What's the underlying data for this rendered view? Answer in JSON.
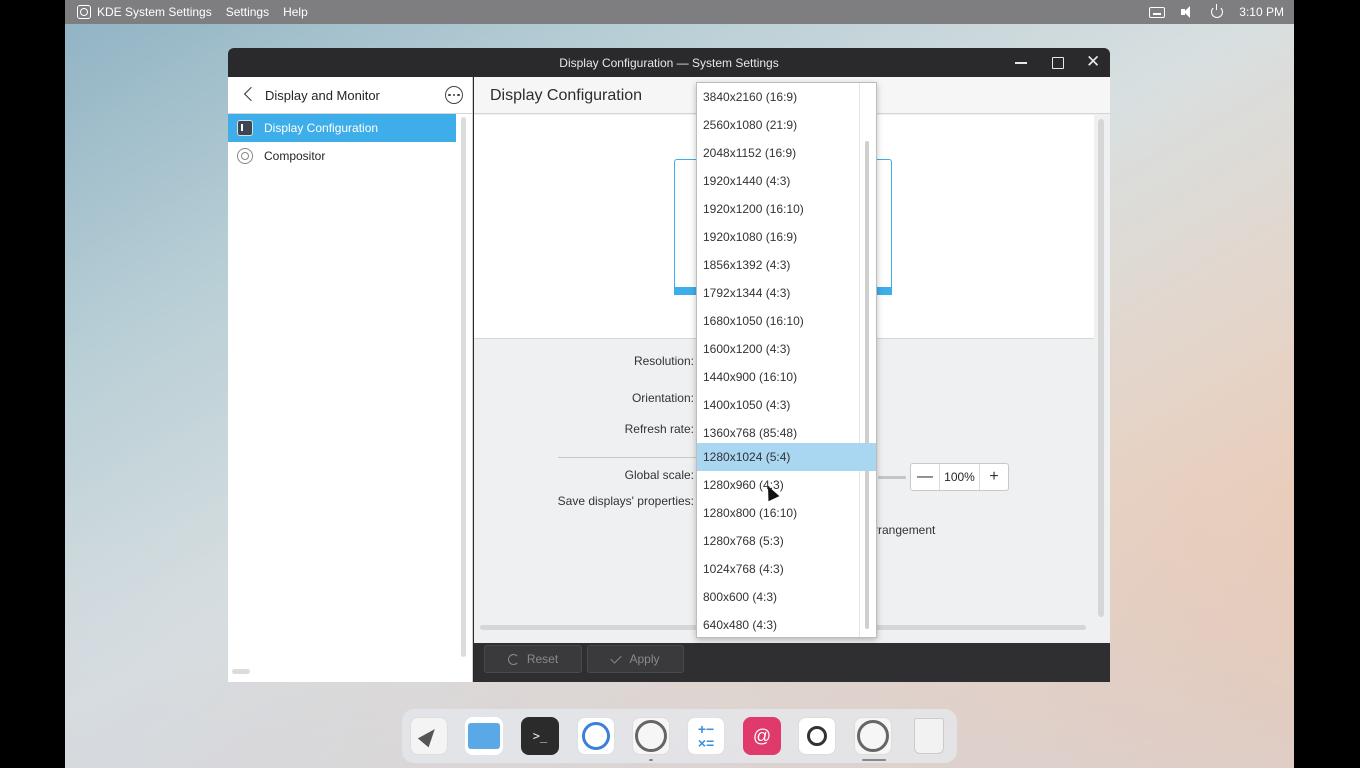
{
  "topbar": {
    "app_name": "KDE System Settings",
    "menu": [
      "Settings",
      "Help"
    ],
    "clock": "3:10 PM"
  },
  "window": {
    "title": "Display Configuration — System Settings",
    "close_glyph": "✕"
  },
  "sidebar": {
    "title": "Display and Monitor",
    "items": [
      {
        "label": "Display Configuration",
        "icon": "display-icon",
        "active": true
      },
      {
        "label": "Compositor",
        "icon": "compositor-icon",
        "active": false
      }
    ]
  },
  "main": {
    "title": "Display Configuration",
    "labels": {
      "resolution": "Resolution:",
      "orientation": "Orientation:",
      "refresh_rate": "Refresh rate:",
      "global_scale": "Global scale:",
      "save_properties": "Save displays' properties:"
    },
    "global_scale_value": "100%",
    "minus_glyph": "—",
    "plus_glyph": "+",
    "arrangement_text": "rrangement"
  },
  "bottombar": {
    "reset_label": "Reset",
    "apply_label": "Apply"
  },
  "resolution_dropdown": {
    "options": [
      "3840x2160 (16:9)",
      "2560x1080 (21:9)",
      "2048x1152 (16:9)",
      "1920x1440 (4:3)",
      "1920x1200 (16:10)",
      "1920x1080 (16:9)",
      "1856x1392 (4:3)",
      "1792x1344 (4:3)",
      "1680x1050 (16:10)",
      "1600x1200 (4:3)",
      "1440x900 (16:10)",
      "1400x1050 (4:3)",
      "1360x768 (85:48)",
      "1280x1024 (5:4)",
      "1280x960 (4:3)",
      "1280x800 (16:10)",
      "1280x768 (5:3)",
      "1024x768 (4:3)",
      "800x600 (4:3)",
      "640x480 (4:3)"
    ],
    "highlighted": "1280x1024 (5:4)"
  },
  "dock": {
    "terminal_glyph": ">_",
    "calculator_glyph": "+−\n×=",
    "debian_glyph": "@",
    "apps": [
      "launcher-icon",
      "files-icon",
      "terminal-icon",
      "browser-icon",
      "settings-icon",
      "calculator-icon",
      "debian-icon",
      "screenshot-icon",
      "settings-icon",
      "trash-icon"
    ]
  },
  "colors": {
    "accent": "#3daee9",
    "highlight": "#a9d6f1",
    "titlebar": "#2a2a2c"
  }
}
